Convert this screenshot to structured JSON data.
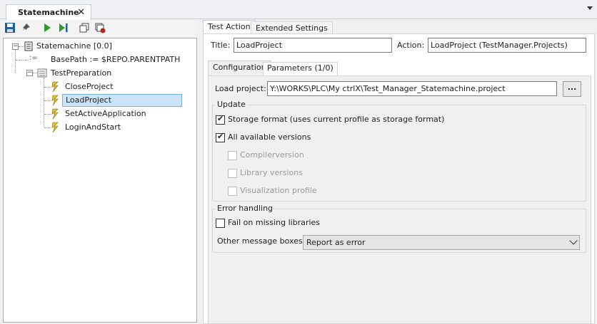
{
  "doc_tab": {
    "title": "Statemachine",
    "close": "✕"
  },
  "tree": {
    "root": "Statemachine [0.0]",
    "basepath": "BasePath := $REPO.PARENTPATH",
    "prep": "TestPreparation",
    "children": [
      "CloseProject",
      "LoadProject",
      "SetActiveApplication",
      "LoginAndStart"
    ],
    "selected": "LoadProject"
  },
  "right": {
    "tabs": [
      "Test Action",
      "Extended Settings"
    ],
    "title_label": "Title:",
    "title_value": "LoadProject",
    "action_label": "Action:",
    "action_value": "LoadProject (TestManager.Projects)",
    "inner_tabs": [
      "Configuration",
      "Parameters (1/0)"
    ],
    "load_label": "Load project:",
    "load_value": "Y:\\WORKS\\PLC\\My ctrlX\\Test_Manager_Statemachine.project",
    "browse": "...",
    "update_group": "Update",
    "storage_format": "Storage format (uses current profile as storage format)",
    "all_versions": "All available versions",
    "compiler": "Compilerversion",
    "library": "Library versions",
    "visualization": "Visualization profile",
    "error_group": "Error handling",
    "fail_missing": "Fail on missing libraries",
    "other_label": "Other message boxes:",
    "other_value": "Report as error"
  },
  "colors": {
    "selection": "#cce4f7",
    "accent_icon": "#1f6fb5",
    "play_green": "#2e9a2e"
  }
}
